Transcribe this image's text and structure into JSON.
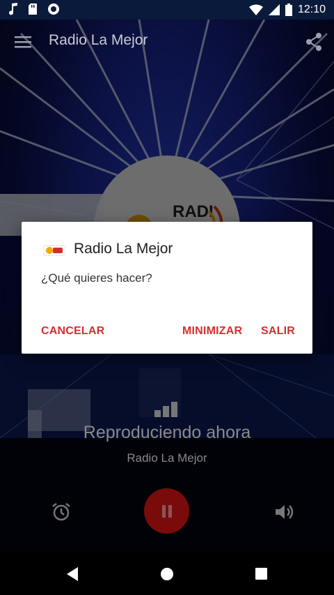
{
  "status_bar": {
    "time": "12:10",
    "left_icons": [
      "music-note-icon",
      "sd-card-icon",
      "record-icon"
    ],
    "right_icons": [
      "wifi-icon",
      "cell-signal-icon",
      "battery-icon"
    ]
  },
  "toolbar": {
    "title": "Radio La Mejor",
    "menu_icon": "hamburger-menu-icon",
    "share_icon": "share-icon"
  },
  "player": {
    "status_text": "Reproduciendo ahora",
    "station_name": "Radio La Mejor",
    "alarm_icon": "alarm-icon",
    "play_pause_icon": "pause-icon",
    "volume_icon": "volume-icon",
    "accent_color": "#7a0b0b"
  },
  "dialog": {
    "title": "Radio La Mejor",
    "message": "¿Qué quieres hacer?",
    "buttons": {
      "cancel": "CANCELAR",
      "minimize": "MINIMIZAR",
      "exit": "SALIR"
    },
    "button_color": "#d32f2f"
  },
  "nav_bar": {
    "icons": [
      "back-icon",
      "home-icon",
      "recents-icon"
    ]
  }
}
